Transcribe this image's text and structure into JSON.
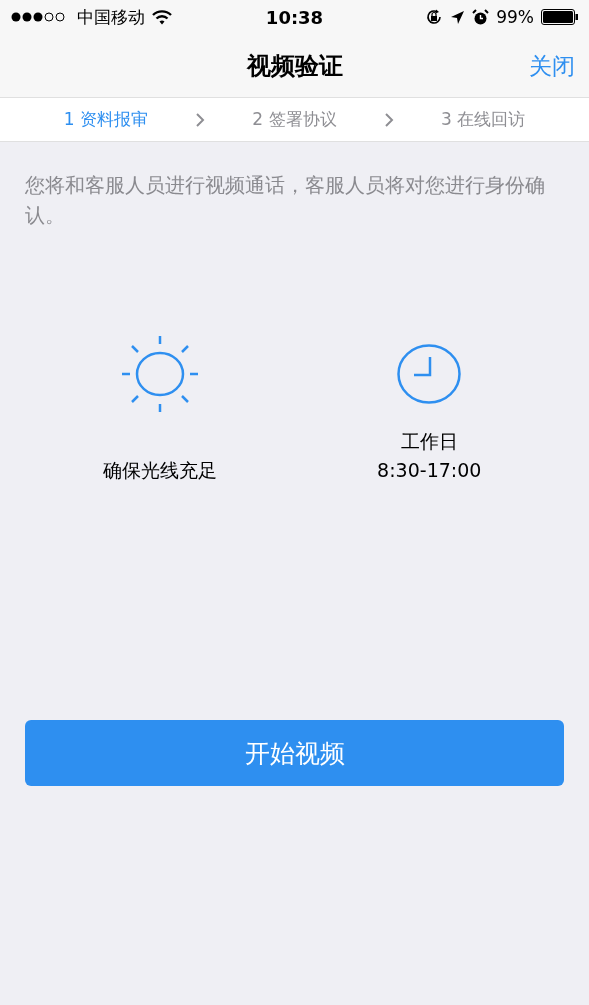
{
  "status_bar": {
    "carrier": "中国移动",
    "time": "10:38",
    "battery": "99%"
  },
  "nav": {
    "title": "视频验证",
    "close": "关闭"
  },
  "steps": [
    {
      "label": "1 资料报审",
      "selected": true
    },
    {
      "label": "2 签署协议",
      "selected": false
    },
    {
      "label": "3 在线回访",
      "selected": false
    }
  ],
  "description": "您将和客服人员进行视频通话，客服人员将对您进行身份确认。",
  "tips": [
    {
      "kind": "sun",
      "lines": [
        "确保光线充足"
      ]
    },
    {
      "kind": "clock",
      "lines": [
        "工作日",
        "8:30-17:00"
      ]
    }
  ],
  "start_button": "开始视频"
}
